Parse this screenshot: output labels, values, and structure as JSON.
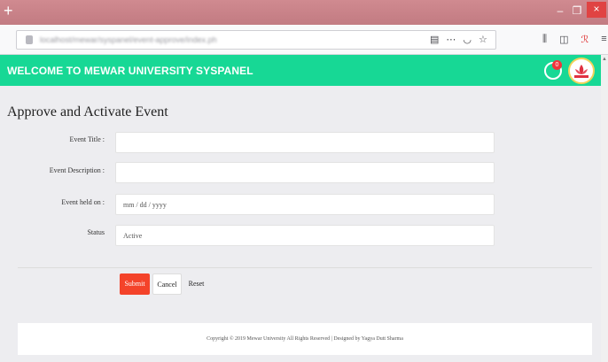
{
  "browser": {
    "new_tab": "+",
    "url": "localhost/mewar/syspanel/event-approve/index.php",
    "window_controls": {
      "minimize": "–",
      "maximize": "❐",
      "close": "×"
    }
  },
  "app": {
    "brand": "WELCOME TO MEWAR UNIVERSITY SYSPANEL",
    "notification_count": "0",
    "accent_color": "#17d895"
  },
  "page": {
    "title": "Approve and Activate Event"
  },
  "form": {
    "event_title": {
      "label": "Event Title :",
      "value": ""
    },
    "event_description": {
      "label": "Event Description :",
      "value": ""
    },
    "event_held_on": {
      "label": "Event held on :",
      "placeholder": "mm / dd / yyyy"
    },
    "status": {
      "label": "Status",
      "value": "Active"
    }
  },
  "buttons": {
    "submit": "Submit",
    "cancel": "Cancel",
    "reset": "Reset",
    "submit_color": "#f4432a"
  },
  "footer": {
    "text": "Copyright © 2019 Mewar University All Rights Reserved | Designed by Yagya Dutt Sharma"
  }
}
